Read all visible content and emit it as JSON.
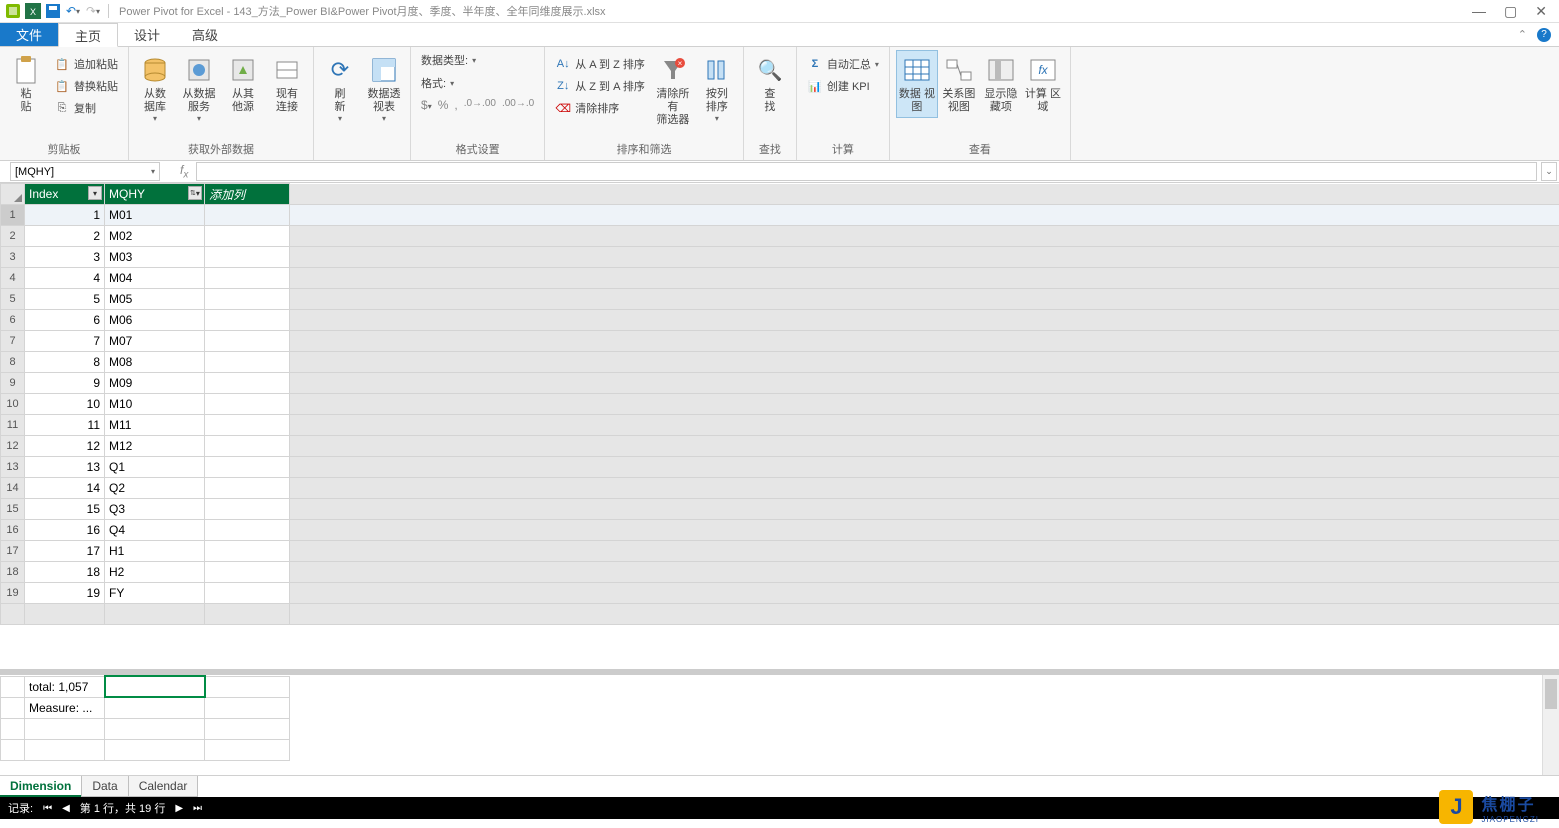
{
  "title": "Power Pivot for Excel - 143_方法_Power BI&Power Pivot月度、季度、半年度、全年同维度展示.xlsx",
  "tabs": {
    "file": "文件",
    "home": "主页",
    "design": "设计",
    "advanced": "高级"
  },
  "ribbon": {
    "clipboard": {
      "paste": "粘\n贴",
      "paste_append": "追加粘贴",
      "paste_replace": "替换粘贴",
      "copy": "复制",
      "label": "剪贴板"
    },
    "external": {
      "from_db": "从数\n据库",
      "from_svc": "从数据\n服务",
      "from_other": "从其\n他源",
      "existing": "现有\n连接",
      "label": "获取外部数据"
    },
    "refresh": {
      "refresh": "刷\n新",
      "pivot": "数据透\n视表"
    },
    "format": {
      "datatype": "数据类型:",
      "fmt": "格式:",
      "label": "格式设置"
    },
    "sort": {
      "az": "从 A 到 Z 排序",
      "za": "从 Z 到 A 排序",
      "clear_sort": "清除排序",
      "clear_filter": "清除所有\n筛选器",
      "by_col": "按列\n排序",
      "label": "排序和筛选"
    },
    "find": {
      "find": "查\n找",
      "label": "查找"
    },
    "calc": {
      "autosum": "自动汇总",
      "kpi": "创建 KPI",
      "label": "计算"
    },
    "view": {
      "data": "数据\n视图",
      "diagram": "关系图\n视图",
      "hidden": "显示隐\n藏项",
      "calc_area": "计算\n区域",
      "label": "查看"
    }
  },
  "name_box": "[MQHY]",
  "columns": {
    "index": "Index",
    "mqhy": "MQHY",
    "add": "添加列"
  },
  "rows": [
    {
      "idx": 1,
      "val": "M01"
    },
    {
      "idx": 2,
      "val": "M02"
    },
    {
      "idx": 3,
      "val": "M03"
    },
    {
      "idx": 4,
      "val": "M04"
    },
    {
      "idx": 5,
      "val": "M05"
    },
    {
      "idx": 6,
      "val": "M06"
    },
    {
      "idx": 7,
      "val": "M07"
    },
    {
      "idx": 8,
      "val": "M08"
    },
    {
      "idx": 9,
      "val": "M09"
    },
    {
      "idx": 10,
      "val": "M10"
    },
    {
      "idx": 11,
      "val": "M11"
    },
    {
      "idx": 12,
      "val": "M12"
    },
    {
      "idx": 13,
      "val": "Q1"
    },
    {
      "idx": 14,
      "val": "Q2"
    },
    {
      "idx": 15,
      "val": "Q3"
    },
    {
      "idx": 16,
      "val": "Q4"
    },
    {
      "idx": 17,
      "val": "H1"
    },
    {
      "idx": 18,
      "val": "H2"
    },
    {
      "idx": 19,
      "val": "FY"
    }
  ],
  "measures": {
    "total": "total: 1,057",
    "measure": "Measure: ..."
  },
  "sheets": {
    "dimension": "Dimension",
    "data": "Data",
    "calendar": "Calendar"
  },
  "status": {
    "record": "记录:",
    "position": "第 1 行，共 19 行"
  },
  "logo": {
    "letter": "J",
    "text": "焦棚子",
    "sub": "JIAOPENGZI"
  }
}
